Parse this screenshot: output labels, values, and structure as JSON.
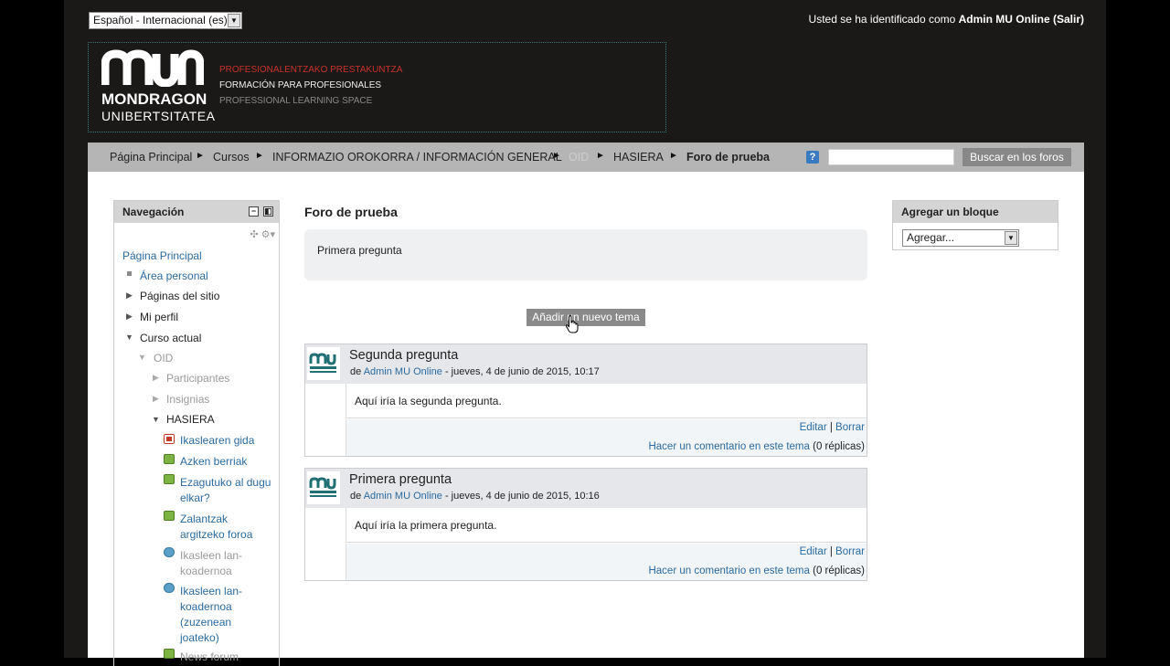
{
  "lang_select": {
    "value": "Español - Internacional (es)"
  },
  "login": {
    "prefix": "Usted se ha identificado como ",
    "user": "Admin MU Online",
    "logout": "(Salir)"
  },
  "logo": {
    "line1": "MONDRAGON",
    "line2": "UNIBERTSITATEA",
    "tag1": "PROFESIONALENTZAKO PRESTAKUNTZA",
    "tag2": "FORMACIÓN PARA PROFESIONALES",
    "tag3": "PROFESSIONAL LEARNING SPACE"
  },
  "breadcrumb": [
    "Página Principal",
    "Cursos",
    "INFORMAZIO OROKORRA / INFORMACIÓN GENERAL",
    "OID",
    "HASIERA",
    "Foro de prueba"
  ],
  "breadcrumb_sep": "►",
  "search": {
    "help": "?",
    "value": "",
    "button": "Buscar en los foros"
  },
  "navigation": {
    "title": "Navegación",
    "tools": "✣ ⚙▾",
    "items": {
      "home": "Página Principal",
      "area": "Área personal",
      "pages": "Páginas del sitio",
      "profile": "Mi perfil",
      "course": "Curso actual",
      "oid": "OID",
      "participants": "Participantes",
      "badges": "Insignias",
      "hasiera": "HASIERA",
      "gida": "Ikaslearen gida",
      "berriak": "Azken berriak",
      "ezagutuko": "Ezagutuko al dugu elkar?",
      "zalantzak": "Zalantzak argitzeko foroa",
      "lan1": "Ikasleen lan-koadernoa",
      "lan2": "Ikasleen lan-koadernoa (zuzenean joateko)",
      "news": "News forum"
    }
  },
  "main": {
    "title": "Foro de prueba",
    "intro": "Primera pregunta",
    "add_topic": "Añadir un nuevo tema",
    "posts": [
      {
        "subject": "Segunda pregunta",
        "by": "de ",
        "author": "Admin MU Online",
        "date": " - jueves, 4 de junio de 2015, 10:17",
        "body": "Aquí iría la segunda pregunta.",
        "edit": "Editar",
        "sep": " | ",
        "delete": "Borrar",
        "reply": "Hacer un comentario en este tema",
        "replies": " (0 réplicas)"
      },
      {
        "subject": "Primera pregunta",
        "by": "de ",
        "author": "Admin MU Online",
        "date": " - jueves, 4 de junio de 2015, 10:16",
        "body": "Aquí iría la primera pregunta.",
        "edit": "Editar",
        "sep": " | ",
        "delete": "Borrar",
        "reply": "Hacer un comentario en este tema",
        "replies": " (0 réplicas)"
      }
    ]
  },
  "add_block": {
    "title": "Agregar un bloque",
    "select": "Agregar..."
  },
  "colors": {
    "link": "#2a6ba1",
    "header_bg": "#1b1918",
    "navbar": "#b5b5b5",
    "accent_red": "#c8312b",
    "teal": "#1f6f75"
  }
}
